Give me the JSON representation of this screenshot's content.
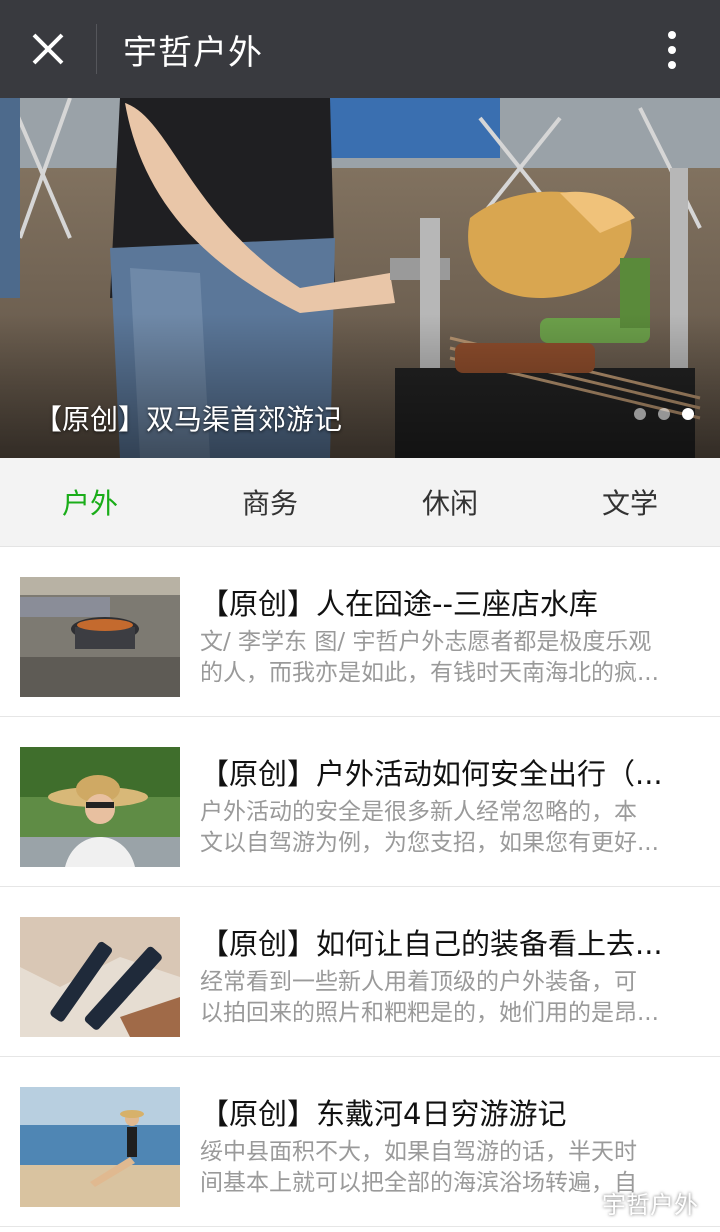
{
  "header": {
    "title": "宇哲户外",
    "close_icon": "close-icon",
    "more_icon": "more-vertical-icon"
  },
  "banner": {
    "caption": "【原创】双马渠首郊游记",
    "indicator_count": 3,
    "indicator_active": 0
  },
  "tabs": [
    {
      "label": "户外",
      "active": true
    },
    {
      "label": "商务",
      "active": false
    },
    {
      "label": "休闲",
      "active": false
    },
    {
      "label": "文学",
      "active": false
    }
  ],
  "articles": [
    {
      "title": "【原创】人在囧途--三座店水库",
      "desc_line1": "文/ 李学东 图/ 宇哲户外志愿者都是极度乐观",
      "desc_line2": "的人，而我亦是如此，有钱时天南海北的疯..."
    },
    {
      "title": "【原创】户外活动如何安全出行（...",
      "desc_line1": "户外活动的安全是很多新人经常忽略的，本",
      "desc_line2": "文以自驾游为例，为您支招，如果您有更好..."
    },
    {
      "title": "【原创】如何让自己的装备看上去...",
      "desc_line1": "经常看到一些新人用着顶级的户外装备，可",
      "desc_line2": "以拍回来的照片和粑粑是的，她们用的是昂..."
    },
    {
      "title": "【原创】东戴河4日穷游游记",
      "desc_line1": "绥中县面积不大，如果自驾游的话，半天时",
      "desc_line2": "间基本上就可以把全部的海滨浴场转遍，自"
    }
  ],
  "watermark": {
    "text": "宇哲户外",
    "icon": "wechat-icon"
  },
  "colors": {
    "header_bg": "#393a3f",
    "tab_active": "#1aad19",
    "tab_bar_bg": "#f3f3f3",
    "desc_text": "#9a9a9a"
  }
}
